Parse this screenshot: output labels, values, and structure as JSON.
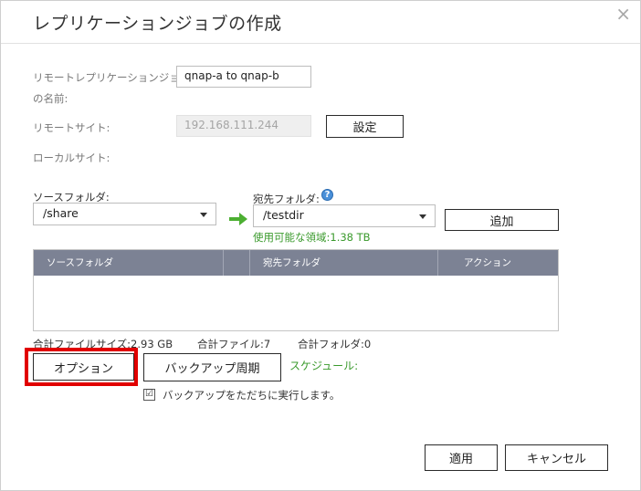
{
  "dialog": {
    "title": "レプリケーションジョブの作成",
    "close_glyph": "×"
  },
  "form": {
    "job_name_label_line1": "リモートレプリケーションジョブ",
    "job_name_label_line2": "の名前:",
    "job_name_value": "qnap-a to qnap-b",
    "remote_site_label": "リモートサイト:",
    "remote_site_value": "192.168.111.244",
    "settings_button": "設定",
    "local_site_label": "ローカルサイト:"
  },
  "folders": {
    "source_label": "ソースフォルダ:",
    "source_value": "/share",
    "dest_label": "宛先フォルダ:",
    "dest_value": "/testdir",
    "available_space": "使用可能な領域:1.38 TB",
    "add_button": "追加",
    "help_glyph": "?"
  },
  "table": {
    "columns": [
      "ソースフォルダ",
      "",
      "宛先フォルダ",
      "アクション"
    ],
    "rows": []
  },
  "summary": {
    "total_file_size": "合計ファイルサイズ:2.93 GB",
    "total_files": "合計ファイル:7",
    "total_folders": "合計フォルダ:0"
  },
  "actions": {
    "options_button": "オプション",
    "backup_schedule_button": "バックアップ周期",
    "schedule_label": "スケジュール:",
    "run_now_checkbox_label": "バックアップをただちに実行します。",
    "run_now_checked": true,
    "checkbox_glyph": "☑",
    "apply_button": "適用",
    "cancel_button": "キャンセル"
  },
  "colors": {
    "highlight": "#e10000",
    "accent_green": "#3a9a2c",
    "table_header": "#7c8294"
  }
}
